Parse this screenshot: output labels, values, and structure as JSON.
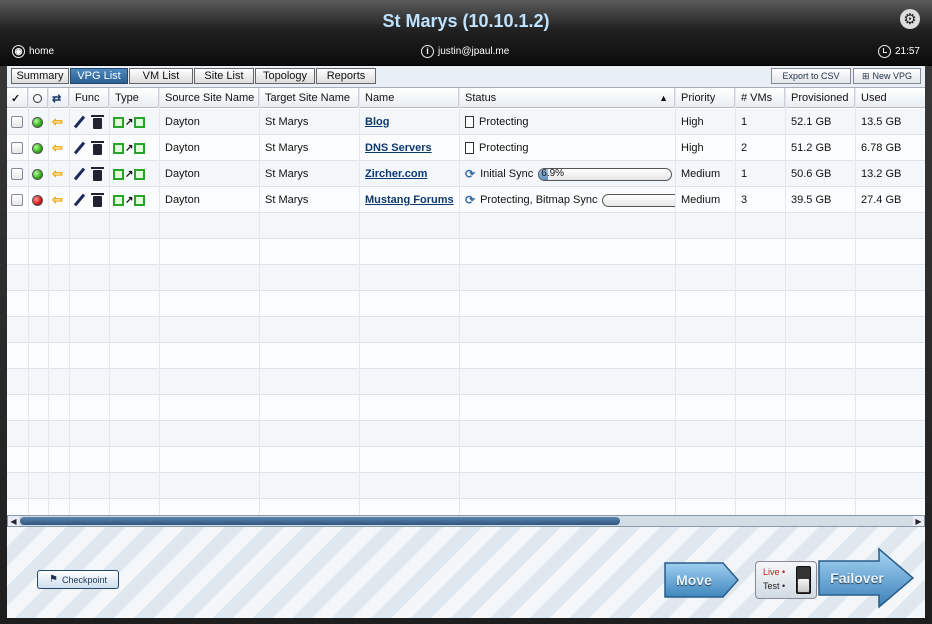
{
  "header": {
    "title": "St Marys (10.10.1.2)",
    "home_label": "home",
    "user": "justin@jpaul.me",
    "time": "21:57"
  },
  "tabs": [
    {
      "label": "Summary",
      "active": false
    },
    {
      "label": "VPG List",
      "active": true
    },
    {
      "label": "VM List",
      "active": false
    },
    {
      "label": "Site List",
      "active": false
    },
    {
      "label": "Topology",
      "active": false
    },
    {
      "label": "Reports",
      "active": false
    }
  ],
  "toolbar": {
    "export_label": "Export to CSV",
    "new_vpg_label": "New VPG"
  },
  "columns": {
    "check": "✓",
    "func": "Func",
    "type": "Type",
    "source": "Source Site Name",
    "target": "Target Site Name",
    "name": "Name",
    "status": "Status",
    "priority": "Priority",
    "vms": "# VMs",
    "provisioned": "Provisioned",
    "used": "Used"
  },
  "rows": [
    {
      "health": "green",
      "source": "Dayton",
      "target": "St Marys",
      "name": "Blog",
      "status": "Protecting",
      "status_icon": "document-icon",
      "progress": null,
      "progress_text": "",
      "priority": "High",
      "vms": "1",
      "provisioned": "52.1 GB",
      "used": "13.5 GB"
    },
    {
      "health": "green",
      "source": "Dayton",
      "target": "St Marys",
      "name": "DNS Servers",
      "status": "Protecting",
      "status_icon": "document-icon",
      "progress": null,
      "progress_text": "",
      "priority": "High",
      "vms": "2",
      "provisioned": "51.2 GB",
      "used": "6.78 GB"
    },
    {
      "health": "green",
      "source": "Dayton",
      "target": "St Marys",
      "name": "Zircher.com",
      "status": "Initial Sync",
      "status_icon": "sync-icon",
      "progress": 6.9,
      "progress_text": "6.9%",
      "priority": "Medium",
      "vms": "1",
      "provisioned": "50.6 GB",
      "used": "13.2 GB"
    },
    {
      "health": "red",
      "source": "Dayton",
      "target": "St Marys",
      "name": "Mustang Forums",
      "status": "Protecting, Bitmap Sync",
      "status_icon": "sync-icon",
      "progress": 0,
      "progress_text": "",
      "priority": "Medium",
      "vms": "3",
      "provisioned": "39.5 GB",
      "used": "27.4 GB"
    }
  ],
  "actions": {
    "checkpoint_label": "Checkpoint",
    "move_label": "Move",
    "failover_label": "Failover",
    "live_label": "Live",
    "test_label": "Test"
  },
  "colors": {
    "accent": "#2b5f91",
    "title": "#bfe3ff",
    "health_ok": "#2eae16",
    "health_error": "#d41414",
    "action_blue": "#4f98cf"
  }
}
